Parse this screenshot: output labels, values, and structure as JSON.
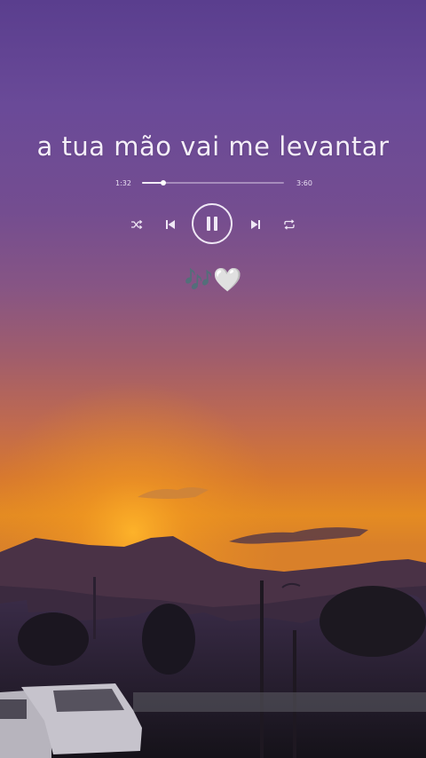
{
  "song": {
    "lyric": "a tua mão vai me levantar"
  },
  "player": {
    "current_time": "1:32",
    "total_time": "3:60",
    "progress_fraction": 0.15,
    "controls": [
      "shuffle-icon",
      "previous-icon",
      "pause-icon",
      "next-icon",
      "repeat-icon"
    ]
  },
  "caption": {
    "emoji": "🎶🤍"
  },
  "colors": {
    "sky_top": "#5a3e8e",
    "horizon": "#e48b22",
    "controls": "#efe7f5"
  }
}
